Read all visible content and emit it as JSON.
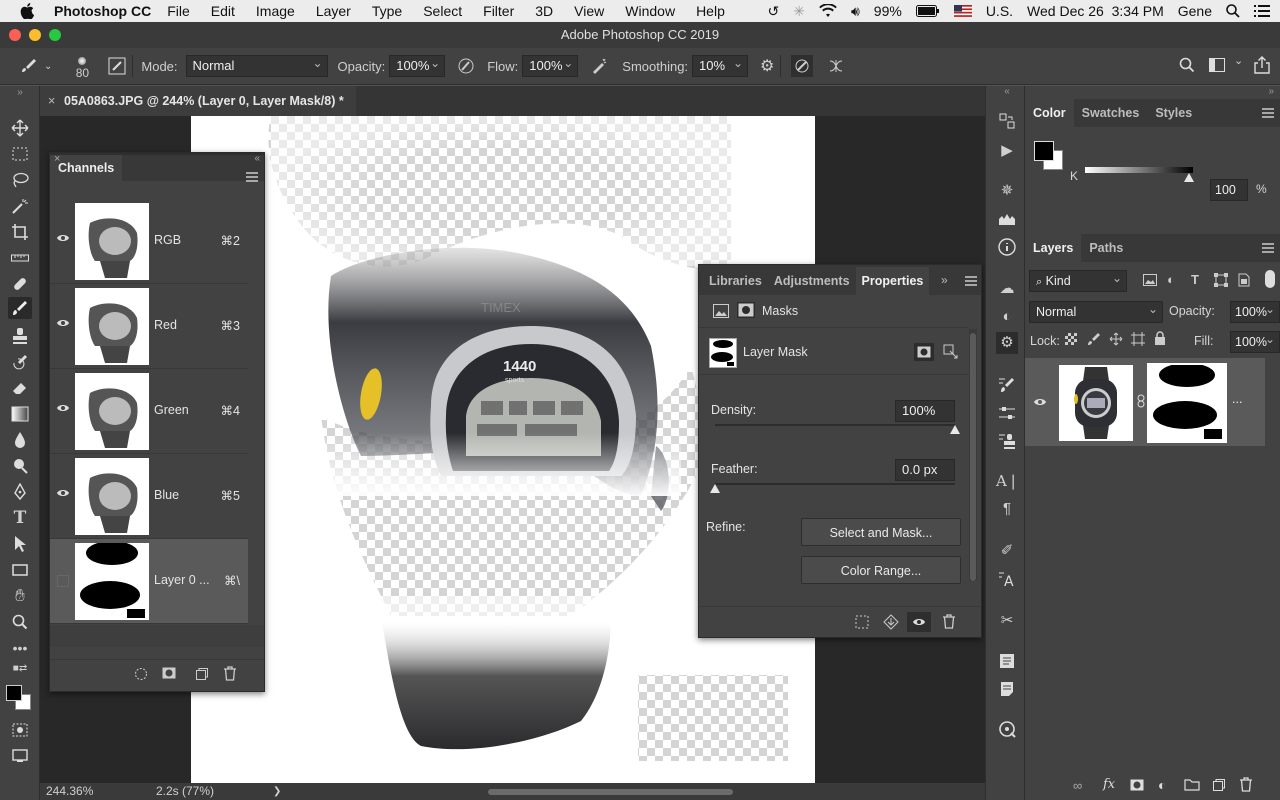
{
  "menubar": {
    "app_name": "Photoshop CC",
    "items": [
      "File",
      "Edit",
      "Image",
      "Layer",
      "Type",
      "Select",
      "Filter",
      "3D",
      "View",
      "Window",
      "Help"
    ],
    "battery": "99%",
    "input_source": "U.S.",
    "datetime": "Wed Dec 26  3:34 PM",
    "user": "Gene"
  },
  "window": {
    "title": "Adobe Photoshop CC 2019"
  },
  "options_bar": {
    "brush_size": "80",
    "mode_label": "Mode:",
    "mode_value": "Normal",
    "opacity_label": "Opacity:",
    "opacity_value": "100%",
    "flow_label": "Flow:",
    "flow_value": "100%",
    "smoothing_label": "Smoothing:",
    "smoothing_value": "10%"
  },
  "document": {
    "tab_title": "05A0863.JPG @ 244% (Layer 0, Layer Mask/8) *",
    "zoom": "244.36%",
    "info": "2.2s (77%)",
    "watch_brand": "1440",
    "watch_sub": "sports",
    "watch_maker": "TIMEX"
  },
  "channels_panel": {
    "title": "Channels",
    "rows": [
      {
        "name": "RGB",
        "shortcut": "⌘2"
      },
      {
        "name": "Red",
        "shortcut": "⌘3"
      },
      {
        "name": "Green",
        "shortcut": "⌘4"
      },
      {
        "name": "Blue",
        "shortcut": "⌘5"
      },
      {
        "name": "Layer 0 ...",
        "shortcut": "⌘\\"
      }
    ]
  },
  "properties_panel": {
    "tabs": [
      "Libraries",
      "Adjustments",
      "Properties"
    ],
    "section": "Masks",
    "mask_name": "Layer Mask",
    "density_label": "Density:",
    "density_value": "100%",
    "density": 1.0,
    "feather_label": "Feather:",
    "feather_value": "0.0 px",
    "feather": 0.0,
    "refine_label": "Refine:",
    "select_and_mask": "Select and Mask...",
    "color_range": "Color Range..."
  },
  "color_panel": {
    "tabs": [
      "Color",
      "Swatches",
      "Styles"
    ],
    "channel_label": "K",
    "k_value": "100",
    "percent": "%"
  },
  "layers_panel": {
    "tabs": [
      "Layers",
      "Paths"
    ],
    "filter_kind": "Kind",
    "blend_mode": "Normal",
    "opacity_label": "Opacity:",
    "opacity_value": "100%",
    "lock_label": "Lock:",
    "fill_label": "Fill:",
    "fill_value": "100%",
    "layer_ellipsis": "..."
  }
}
